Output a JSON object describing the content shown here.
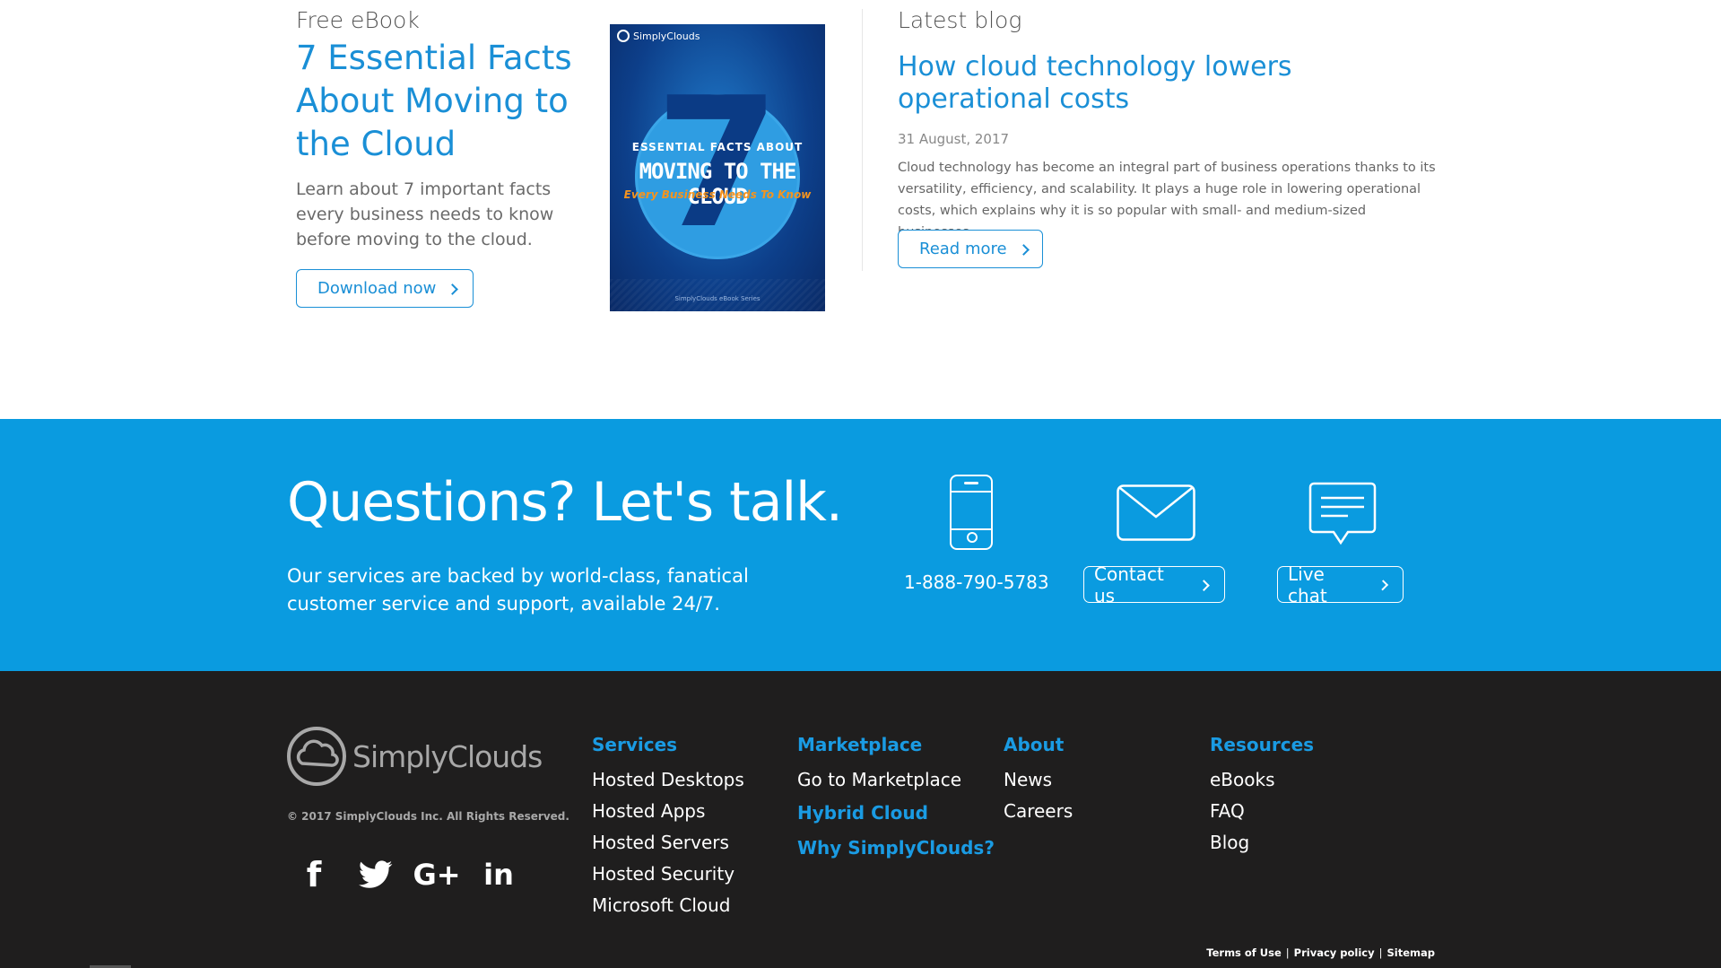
{
  "ebook": {
    "eyebrow": "Free eBook",
    "title": "7 Essential Facts About Moving to the Cloud",
    "description": "Learn about 7 important facts every business needs to know before moving to the cloud.",
    "button": "Download now",
    "cover": {
      "brand": "SimplyClouds",
      "number": "7",
      "line1": "ESSENTIAL FACTS ABOUT",
      "line2": "MOVING TO THE CLOUD",
      "line3": "Every Business Needs To Know",
      "footer": "SimplyClouds eBook Series"
    }
  },
  "blog": {
    "eyebrow": "Latest blog",
    "title": "How cloud technology lowers operational costs",
    "date": "31 August, 2017",
    "excerpt": "Cloud technology has become an integral part of business operations thanks to its versatility, efficiency, and scalability. It plays a huge role in lowering operational costs, which explains why it is so popular with small- and medium-sized businesses.",
    "button": "Read more"
  },
  "contact": {
    "title": "Questions? Let's talk.",
    "subtitle": "Our services are backed by world-class, fanatical customer service and support, available 24/7.",
    "phone": "1-888-790-5783",
    "contact_button": "Contact us",
    "chat_button": "Live chat",
    "colors": {
      "band": "#0a9be0"
    }
  },
  "footer": {
    "brand": "SimplyClouds",
    "copyright": "© 2017 SimplyClouds Inc. All Rights Reserved.",
    "social": {
      "facebook": "f",
      "google": "G+",
      "linkedin": "in",
      "icons": [
        "facebook-icon",
        "twitter-icon",
        "google-plus-icon",
        "linkedin-icon"
      ]
    },
    "services": {
      "heading": "Services",
      "items": [
        "Hosted Desktops",
        "Hosted Apps",
        "Hosted Servers",
        "Hosted Security",
        "Microsoft Cloud"
      ]
    },
    "marketplace": {
      "heading": "Marketplace",
      "items": [
        "Go to Marketplace"
      ],
      "accent_items": [
        "Hybrid Cloud",
        "Why SimplyClouds?"
      ]
    },
    "about": {
      "heading": "About",
      "items": [
        "News",
        "Careers"
      ]
    },
    "resources": {
      "heading": "Resources",
      "items": [
        "eBooks",
        "FAQ",
        "Blog"
      ]
    },
    "legal": {
      "terms": "Terms of Use",
      "privacy": "Privacy policy",
      "sitemap": "Sitemap",
      "separator": "|"
    },
    "colors": {
      "background": "#1f1e1e",
      "accent": "#1a9be3"
    }
  }
}
